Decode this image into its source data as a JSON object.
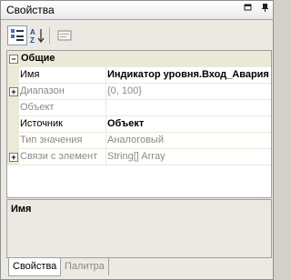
{
  "window": {
    "title": "Свойства"
  },
  "toolbar": {
    "buttons": [
      {
        "icon": "categorized-icon"
      },
      {
        "icon": "alphabetical-sort-icon"
      },
      {
        "icon": "property-pages-icon"
      }
    ]
  },
  "grid": {
    "category": {
      "expand": "−",
      "label": "Общие"
    },
    "rows": [
      {
        "name": "Имя",
        "value": "Индикатор уровня.Вход_Авария",
        "expand": ""
      },
      {
        "name": "Диапазон",
        "value": "{0, 100}",
        "expand": "+"
      },
      {
        "name": "Объект",
        "value": "",
        "expand": ""
      },
      {
        "name": "Источник",
        "value": "Объект",
        "expand": ""
      },
      {
        "name": "Тип значения",
        "value": "Аналоговый",
        "expand": ""
      },
      {
        "name": "Связи с элемент",
        "value": "String[] Array",
        "expand": "+"
      }
    ]
  },
  "description": {
    "title": "Имя"
  },
  "tabs": {
    "properties": "Свойства",
    "palette": "Палитра"
  }
}
